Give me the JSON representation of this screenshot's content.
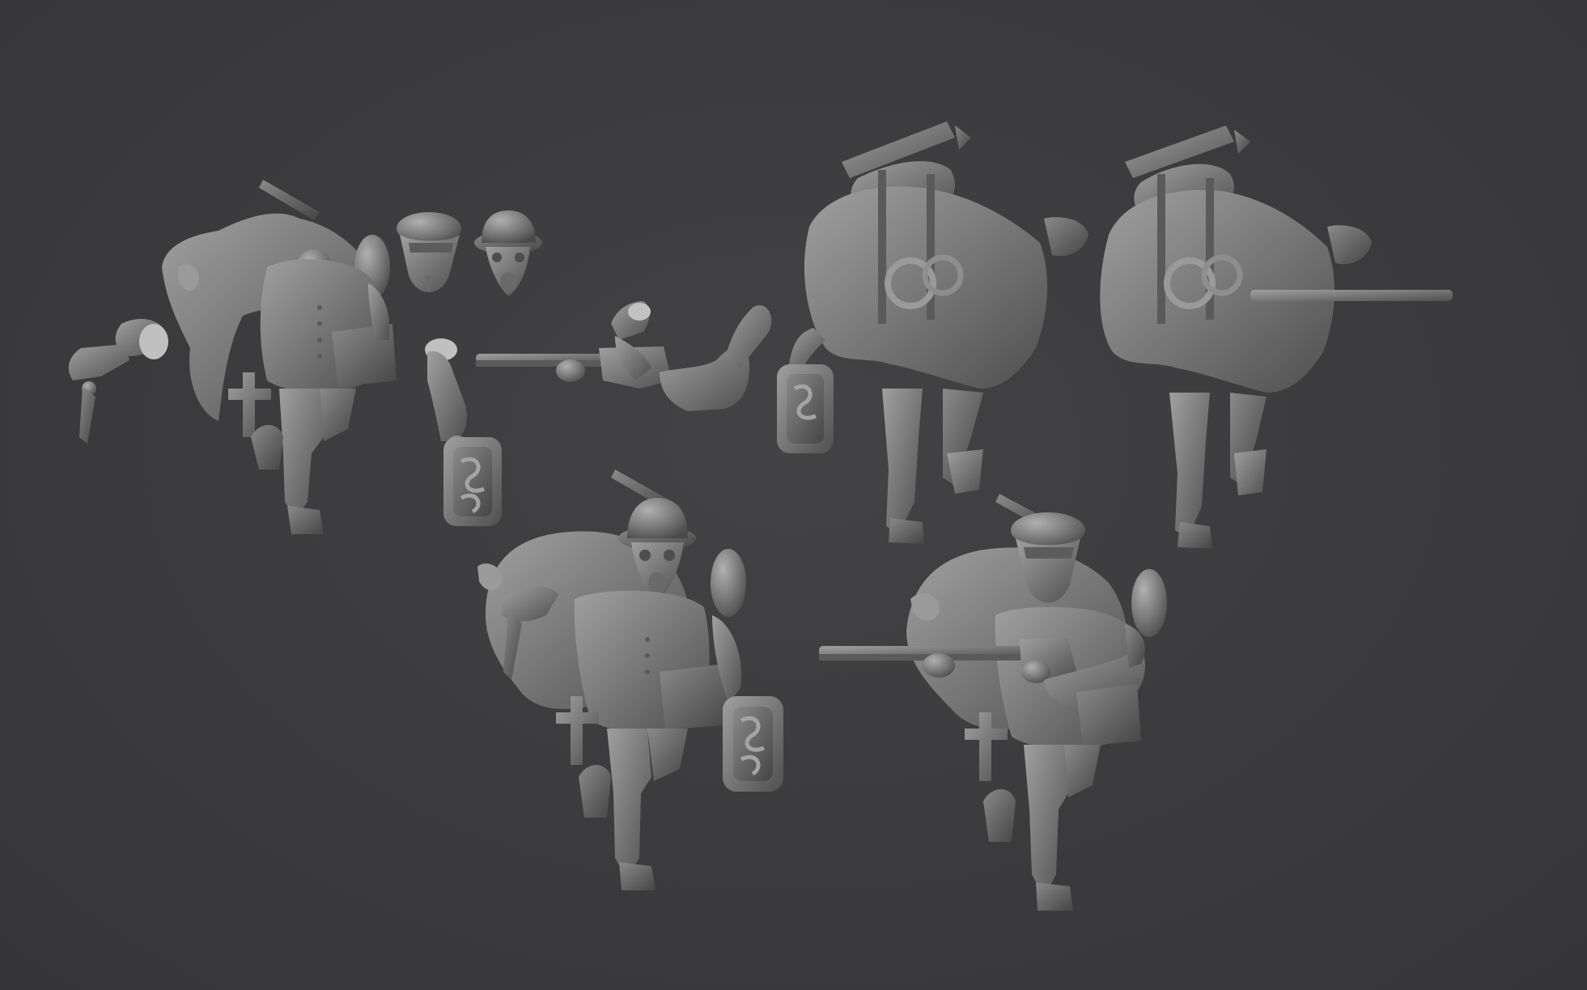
{
  "scene": {
    "background_color": "#3b3b3d",
    "model_color": "#7c7c7c",
    "model_shadow_color": "#4f4f4f",
    "model_highlight_color": "#a2a2a2",
    "objects": [
      {
        "name": "figure-kit-body-front"
      },
      {
        "name": "detached-left-arm-with-knife"
      },
      {
        "name": "officer-cap-head"
      },
      {
        "name": "helmet-gasmask-head"
      },
      {
        "name": "detached-rifle-with-arms"
      },
      {
        "name": "detached-arm-with-case"
      },
      {
        "name": "figure-rear-view-1"
      },
      {
        "name": "figure-rear-view-2"
      },
      {
        "name": "assembled-figure-gasmask-case"
      },
      {
        "name": "assembled-figure-officer-rifle"
      }
    ]
  }
}
